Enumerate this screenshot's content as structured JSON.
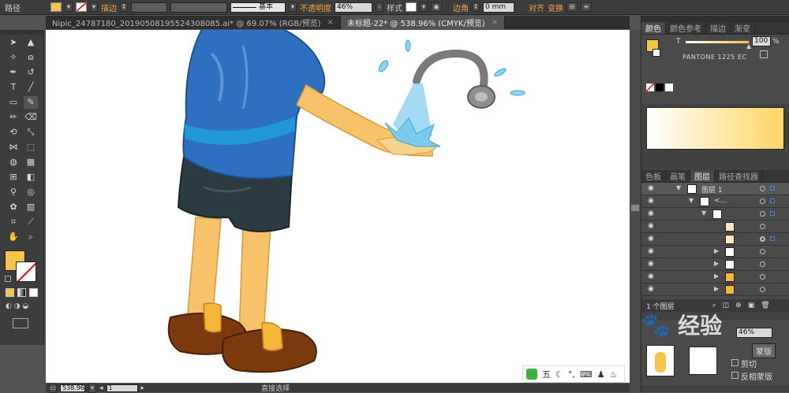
{
  "control_bar": {
    "selection_label": "路径",
    "stroke_label": "描边",
    "stroke_style_label": "基本",
    "opacity_label": "不透明度",
    "opacity_value": "46%",
    "style_label": "样式",
    "corner_label": "边角",
    "corner_value": "0 mm",
    "align_label": "对齐",
    "transform_label": "变换",
    "fill_color": "#f5c54a"
  },
  "tabs": [
    {
      "label": "Nipic_24787180_20190508195524308085.ai* @ 69.07% (RGB/预览)",
      "close": "×"
    },
    {
      "label": "未标题-22* @ 538.96% (CMYK/预览)",
      "close": "×"
    }
  ],
  "status_bar": {
    "zoom": "538.96",
    "page": "1",
    "tool_name": "直接选择"
  },
  "color_panel": {
    "tabs": [
      "颜色",
      "颜色参考",
      "描边",
      "渐变"
    ],
    "tint_label": "T",
    "tint_value": "100",
    "tint_unit": "%",
    "swatch_name": "PANTONE 1225 EC",
    "gradient_from": "#ffffff",
    "gradient_to": "#ffd566"
  },
  "layers_panel": {
    "tabs": [
      "色板",
      "画笔",
      "图层",
      "路径查找器"
    ],
    "top_layer_name": "图层 1",
    "group_name": "<...",
    "footer_count": "1 个图层"
  },
  "lower_panel": {
    "opacity_value": "46%",
    "mask_label": "蒙版",
    "clip_label": "剪切",
    "invert_label": "反相蒙版"
  },
  "ime_bar": {
    "label": "五"
  },
  "watermark": {
    "text": "经验"
  }
}
